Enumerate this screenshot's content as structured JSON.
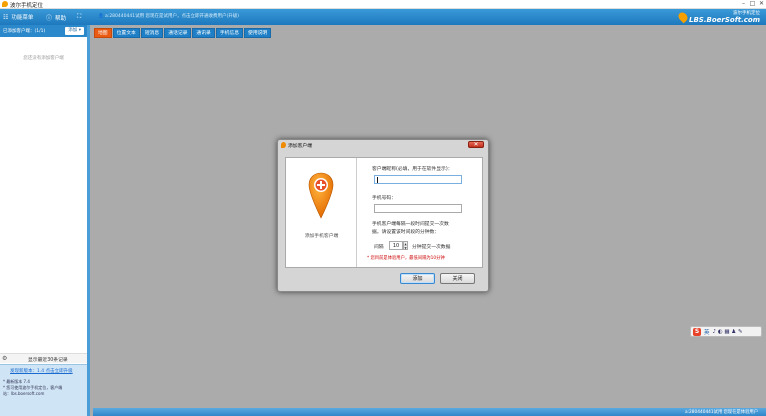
{
  "window": {
    "title": "波尔手机定位"
  },
  "menu": {
    "items": [
      {
        "label": "功能菜单"
      },
      {
        "label": "帮助"
      }
    ],
    "user_info": "a:280440441试用 您现在是试用户，点击立即开通收费用户(升级)",
    "brand_line1": "波尔手机定位",
    "brand_line2": "LBS.BoerSoft.com"
  },
  "sidebar": {
    "header_count": "已添加客户端：(1/1)",
    "add_label": "添加",
    "empty_text": "您还没有添加客户端",
    "recent_label": "显示最近30条记录",
    "version_link": "发现新版本：1.4 点击立即升级",
    "version_current": "* 最新版本 7.4",
    "version_line2": "* 您可使用波尔手机定位，客户端",
    "version_line3": "站：lbs.boersoft.com"
  },
  "tabs": [
    {
      "label": "地图",
      "active": true
    },
    {
      "label": "位置文本",
      "active": false
    },
    {
      "label": "短消息",
      "active": false
    },
    {
      "label": "通话记录",
      "active": false
    },
    {
      "label": "通讯录",
      "active": false
    },
    {
      "label": "手机信息",
      "active": false
    },
    {
      "label": "使用说明",
      "active": false
    }
  ],
  "dialog": {
    "title": "添加客户端",
    "close_glyph": "✕",
    "left_label": "添加手机客户端",
    "nickname_label": "客户端昵称(必填，用于在软件显示)：",
    "nickname_value": "",
    "phone_label": "手机号码：",
    "phone_value": "",
    "interval_desc_1": "手机客户端每隔一段时间提交一次数",
    "interval_desc_2": "据，请设置该时间段的分钟数：",
    "interval_prefix": "间隔",
    "interval_value": "10",
    "interval_suffix": "分钟提交一次数据",
    "note": "* 您目前是体验用户，最低间隔为10分钟",
    "add_button": "添加",
    "close_button": "关闭"
  },
  "ime": {
    "lang": "英",
    "glyphs": "♪ ◐ ▦ ♟ ✎"
  },
  "statusbar": {
    "text": "a:280440441试用 您现在是体验用户"
  },
  "colors": {
    "accent": "#2b88ca",
    "active_tab": "#ea5a10",
    "pin": "#f08a00",
    "note": "#cc0000"
  }
}
